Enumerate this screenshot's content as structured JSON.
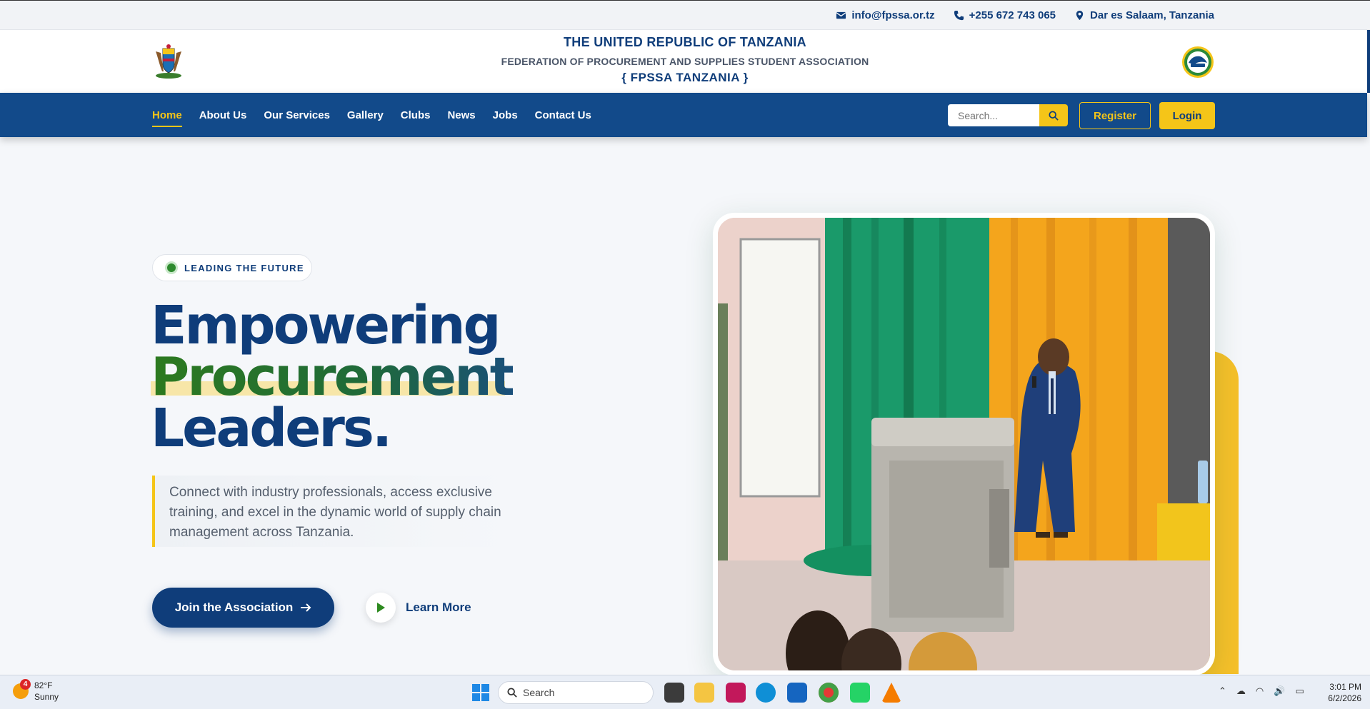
{
  "topbar": {
    "email": "info@fpssa.or.tz",
    "phone": "+255 672 743 065",
    "location": "Dar es Salaam, Tanzania"
  },
  "header": {
    "title": "THE UNITED REPUBLIC OF TANZANIA",
    "subtitle": "FEDERATION OF PROCUREMENT AND SUPPLIES STUDENT ASSOCIATION",
    "acronym": "{ FPSSA TANZANIA }"
  },
  "nav": {
    "items": [
      {
        "label": "Home",
        "active": true
      },
      {
        "label": "About Us"
      },
      {
        "label": "Our Services"
      },
      {
        "label": "Gallery"
      },
      {
        "label": "Clubs"
      },
      {
        "label": "News"
      },
      {
        "label": "Jobs"
      },
      {
        "label": "Contact Us"
      }
    ],
    "search_placeholder": "Search...",
    "register": "Register",
    "login": "Login"
  },
  "hero": {
    "badge": "LEADING THE FUTURE",
    "line1": "Empowering",
    "line2": "Procurement",
    "line3": "Leaders.",
    "description": "Connect with industry professionals, access exclusive training, and excel in the dynamic world of supply chain management across Tanzania.",
    "join_button": "Join the Association",
    "learn_button": "Learn More"
  },
  "taskbar": {
    "weather_temp": "82°F",
    "weather_cond": "Sunny",
    "weather_badge": "4",
    "search": "Search",
    "time": "3:01 PM",
    "date": "6/2/2026"
  },
  "colors": {
    "primary": "#124a8a",
    "accent": "#f5c518",
    "green": "#2d7a1f"
  }
}
